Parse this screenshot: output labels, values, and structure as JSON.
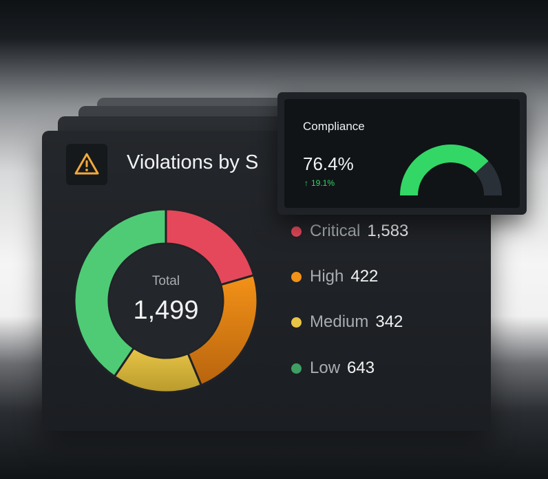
{
  "card": {
    "title": "Violations by S",
    "icon": "warning-triangle-icon"
  },
  "chart_data": [
    {
      "type": "pie",
      "donut": true,
      "center_label": "Total",
      "center_value": "1,499",
      "categories": [
        "Critical",
        "High",
        "Medium",
        "Low"
      ],
      "display_values": [
        "1,583",
        "422",
        "342",
        "643"
      ],
      "slice_fractions": [
        0.205,
        0.232,
        0.158,
        0.405
      ],
      "colors": [
        "#e5485a",
        "#f39218",
        "#e8c547",
        "#4fcb76"
      ],
      "legend_position": "right"
    },
    {
      "type": "gauge",
      "title": "Compliance",
      "value_label": "76.4%",
      "value": 76.4,
      "range": [
        0,
        100
      ],
      "delta_label": "19.1%",
      "delta_direction": "up",
      "colors": {
        "fill": "#33d766",
        "track": "#2a3038",
        "delta": "#33d766"
      }
    }
  ],
  "colors": {
    "card_background": "#202327",
    "accent_warning": "#f3a93b"
  }
}
